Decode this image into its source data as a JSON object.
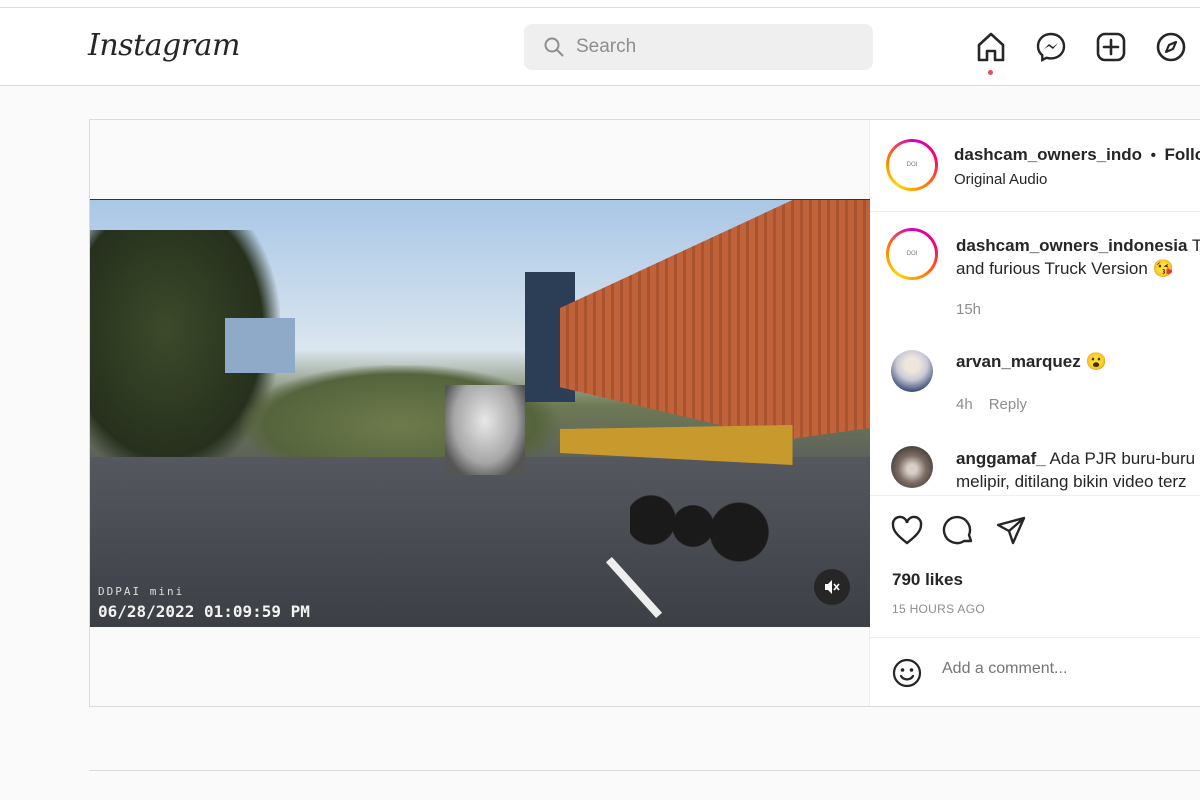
{
  "nav": {
    "logo": "Instagram",
    "search_placeholder": "Search",
    "icons": [
      "home-icon",
      "messenger-icon",
      "new-post-icon",
      "explore-icon"
    ],
    "notification_color": "#ed4956"
  },
  "video": {
    "dashcam_brand": "DDPAI mini",
    "timestamp": "06/28/2022 01:09:59 PM",
    "muted": true
  },
  "post": {
    "author": "dashcam_owners_indo",
    "separator": "•",
    "follow_label": "Follow",
    "audio": "Original Audio",
    "avatar_text": "DASHCAM OWNERS INDONESIA",
    "caption": {
      "user": "dashcam_owners_indonesia",
      "text_line1": "Th",
      "text_line2": "and furious Truck Version 😘",
      "time": "15h"
    },
    "comments": [
      {
        "user": "arvan_marquez",
        "text": "😮",
        "time": "4h",
        "reply": "Reply"
      },
      {
        "user": "anggamaf_",
        "text_line1": "Ada PJR buru-buru",
        "text_line2": "melipir, ditilang bikin video terz"
      }
    ],
    "likes": "790 likes",
    "posted": "15 HOURS AGO",
    "comment_placeholder": "Add a comment..."
  },
  "colors": {
    "accent": "#0095f6",
    "text": "#262626",
    "muted": "#8e8e8e"
  }
}
